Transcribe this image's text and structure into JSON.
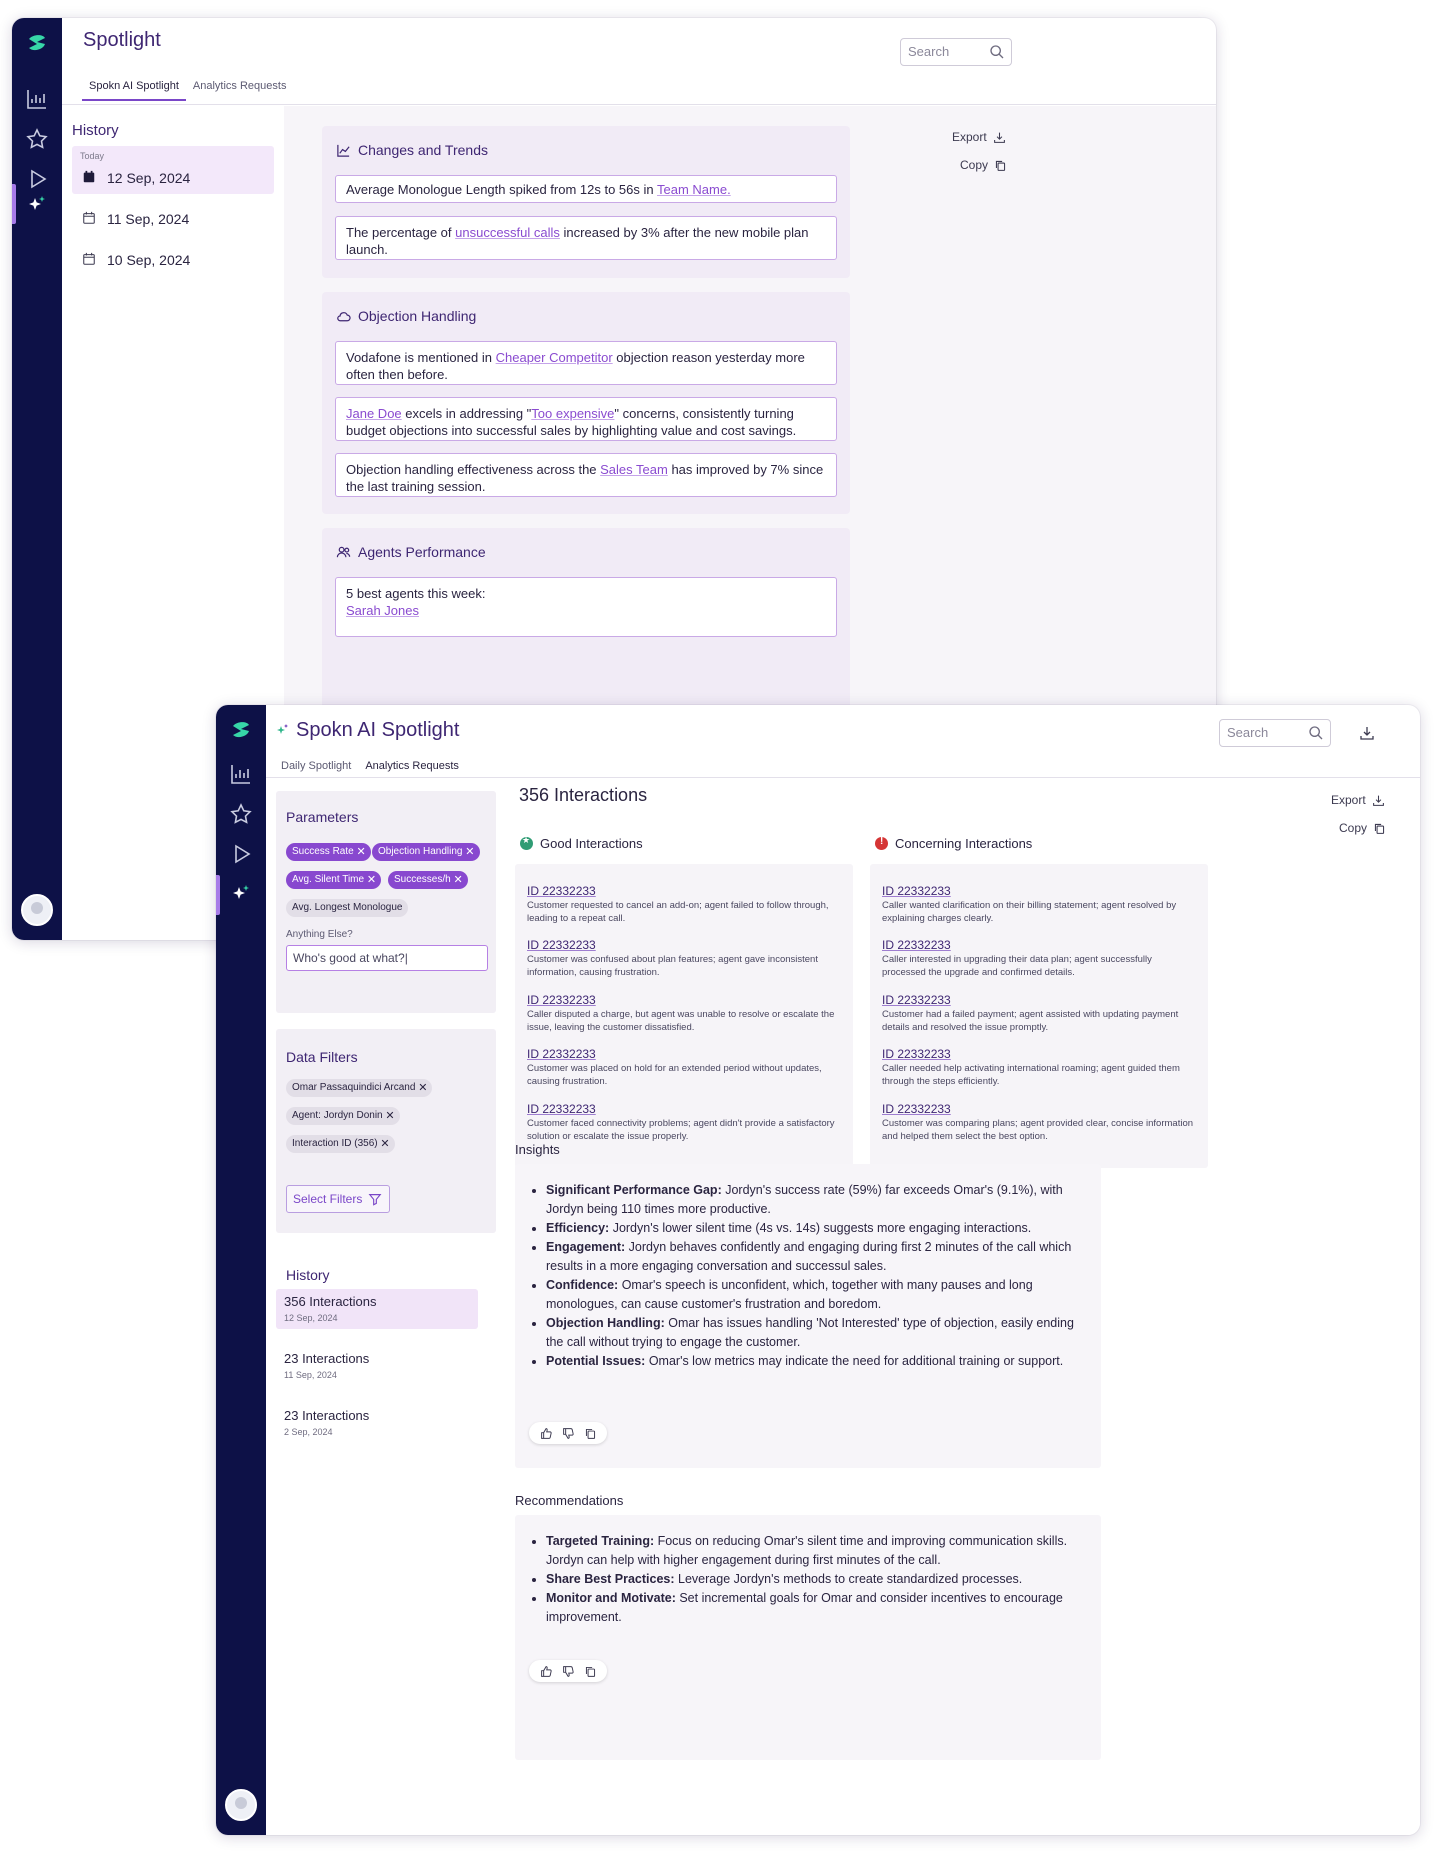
{
  "window1": {
    "title": "Spotlight",
    "tabs": [
      "Spokn AI Spotlight",
      "Analytics Requests"
    ],
    "search_placeholder": "Search",
    "history": {
      "heading": "History",
      "today_label": "Today",
      "days": [
        "12 Sep, 2024",
        "11 Sep, 2024",
        "10 Sep, 2024"
      ]
    },
    "export_label": "Export",
    "copy_label": "Copy",
    "changes": {
      "title": "Changes and Trends",
      "item1_pre": "Average Monologue Length spiked from 12s to 56s in ",
      "item1_link": "Team Name.",
      "item2_pre": "The percentage of ",
      "item2_link": "unsuccessful calls",
      "item2_post": " increased by 3% after the new mobile plan launch."
    },
    "objection": {
      "title": "Objection Handling",
      "item1_pre": "Vodafone is mentioned in ",
      "item1_link": "Cheaper Competitor",
      "item1_post": " objection reason yesterday more often then before.",
      "item2_link1": "Jane Doe",
      "item2_mid": " excels in addressing \"",
      "item2_link2": "Too expensive",
      "item2_post": "\" concerns, consistently turning budget objections into successful sales by highlighting value and cost savings.",
      "item3_pre": "Objection handling effectiveness across the ",
      "item3_link": "Sales Team",
      "item3_post": " has improved by 7% since the last training session."
    },
    "agents": {
      "title": "Agents Performance",
      "item1": "5 best agents this week:",
      "item1_link": "Sarah Jones"
    }
  },
  "window2": {
    "title": "Spokn AI Spotlight",
    "tabs": [
      "Daily Spotlight",
      "Analytics Requests"
    ],
    "search_placeholder": "Search",
    "parameters": {
      "heading": "Parameters",
      "chips": [
        "Success Rate",
        "Objection Handling",
        "Avg. Silent Time",
        "Successes/h"
      ],
      "grey_chip": "Avg. Longest Monologue",
      "anything_label": "Anything Else?",
      "anything_value": "Who's good at what?|"
    },
    "filters": {
      "heading": "Data Filters",
      "chips": [
        "Omar Passaquindici Arcand",
        "Agent: Jordyn Donin",
        "Interaction ID (356)"
      ],
      "select_label": "Select Filters"
    },
    "history": {
      "heading": "History",
      "items": [
        {
          "title": "356 Interactions",
          "date": "12 Sep, 2024"
        },
        {
          "title": "23 Interactions",
          "date": "11 Sep, 2024"
        },
        {
          "title": "23 Interactions",
          "date": "2 Sep, 2024"
        }
      ]
    },
    "main_title": "356 Interactions",
    "export_label": "Export",
    "copy_label": "Copy",
    "good": {
      "heading": "Good Interactions",
      "items": [
        {
          "id": "ID 22332233",
          "desc": "Customer requested to cancel an add-on; agent failed to follow through, leading to a repeat call."
        },
        {
          "id": "ID 22332233",
          "desc": "Customer was confused about plan features; agent gave inconsistent information, causing frustration."
        },
        {
          "id": "ID 22332233",
          "desc": "Caller disputed a charge, but agent was unable to resolve or escalate the issue, leaving the customer dissatisfied."
        },
        {
          "id": "ID 22332233",
          "desc": "Customer was placed on hold for an extended period without updates, causing frustration."
        },
        {
          "id": "ID 22332233",
          "desc": "Customer faced connectivity problems; agent didn't provide a satisfactory solution or escalate the issue properly."
        }
      ]
    },
    "concerning": {
      "heading": "Concerning Interactions",
      "items": [
        {
          "id": "ID 22332233",
          "desc": "Caller wanted clarification on their billing statement; agent resolved by explaining charges clearly."
        },
        {
          "id": "ID 22332233",
          "desc": "Caller interested in upgrading their data plan; agent successfully processed the upgrade and confirmed details."
        },
        {
          "id": "ID 22332233",
          "desc": "Customer had a failed payment; agent assisted with updating payment details and resolved the issue promptly."
        },
        {
          "id": "ID 22332233",
          "desc": "Caller needed help activating international roaming; agent guided them through the steps efficiently."
        },
        {
          "id": "ID 22332233",
          "desc": "Customer was comparing plans; agent provided clear, concise information and helped them select the best option."
        }
      ]
    },
    "insights": {
      "heading": "Insights",
      "items": [
        {
          "label": "Significant Performance Gap:",
          "text": " Jordyn's success rate (59%) far exceeds Omar's (9.1%), with Jordyn being 110 times more productive."
        },
        {
          "label": "Efficiency:",
          "text": " Jordyn's lower silent time (4s vs. 14s) suggests more engaging interactions."
        },
        {
          "label": "Engagement:",
          "text": " Jordyn behaves confidently and engaging during first 2 minutes of the call which results in a more engaging conversation and successul sales."
        },
        {
          "label": "Confidence:",
          "text": " Omar's speech is unconfident, which, together with many pauses and long monologues, can cause customer's frustration and boredom."
        },
        {
          "label": "Objection Handling:",
          "text": " Omar has issues handling 'Not Interested' type of objection, easily ending the call without trying to engage the customer."
        },
        {
          "label": "Potential Issues:",
          "text": " Omar's low metrics may indicate the need for additional training or support."
        }
      ]
    },
    "recommendations": {
      "heading": "Recommendations",
      "items": [
        {
          "label": "Targeted Training:",
          "text": " Focus on reducing Omar's silent time and improving communication skills. Jordyn can help with higher engagement during first minutes of the call."
        },
        {
          "label": "Share Best Practices:",
          "text": " Leverage Jordyn's methods to create standardized processes."
        },
        {
          "label": "Monitor and Motivate:",
          "text": " Set incremental goals for Omar and consider incentives to encourage improvement."
        }
      ]
    }
  }
}
